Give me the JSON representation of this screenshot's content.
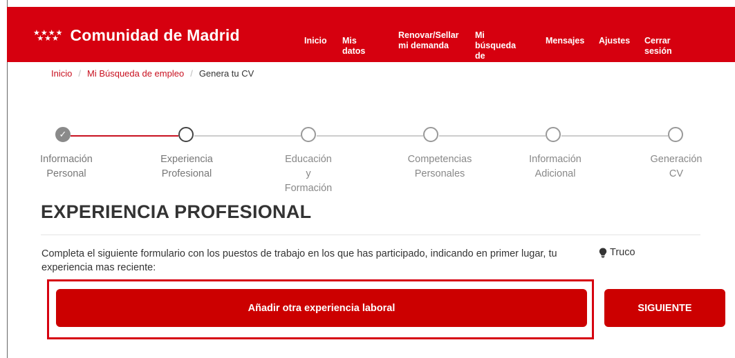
{
  "header": {
    "logo_stars_top": "★★★★",
    "logo_stars_bottom": "★★★",
    "logo_text": "Comunidad de Madrid",
    "nav": [
      {
        "line1": "Inicio",
        "line2": ""
      },
      {
        "line1": "Mis datos",
        "line2": ""
      },
      {
        "line1": "Renovar/Sellar",
        "line2": "mi demanda"
      },
      {
        "line1": "Mi búsqueda",
        "line2": "de empleo"
      },
      {
        "line1": "Mensajes",
        "line2": ""
      },
      {
        "line1": "Ajustes",
        "line2": ""
      },
      {
        "line1": "Cerrar sesión",
        "line2": ""
      }
    ]
  },
  "breadcrumb": {
    "items": [
      "Inicio",
      "Mi Búsqueda de empleo"
    ],
    "current": "Genera tu CV",
    "separator": "/"
  },
  "stepper": {
    "steps": [
      {
        "line1": "Información",
        "line2": "Personal",
        "line3": "",
        "status": "done",
        "check": "✓"
      },
      {
        "line1": "Experiencia",
        "line2": "Profesional",
        "line3": "",
        "status": "current"
      },
      {
        "line1": "Educación",
        "line2": "y",
        "line3": "Formación",
        "status": "pending"
      },
      {
        "line1": "Competencias",
        "line2": "Personales",
        "line3": "",
        "status": "pending"
      },
      {
        "line1": "Información",
        "line2": "Adicional",
        "line3": "",
        "status": "pending"
      },
      {
        "line1": "Generación",
        "line2": "CV",
        "line3": "",
        "status": "pending"
      }
    ]
  },
  "main": {
    "title": "EXPERIENCIA PROFESIONAL",
    "description": "Completa el siguiente formulario con los puestos de trabajo en los que has participado, indicando en primer lugar, tu experiencia mas reciente:",
    "tip_label": "Truco",
    "tip_icon": "lightbulb-icon",
    "add_button": "Añadir otra experiencia laboral",
    "next_button": "SIGUIENTE"
  },
  "colors": {
    "brand_red": "#d6000f",
    "button_red": "#cc0000",
    "link_red": "#c8101f"
  }
}
